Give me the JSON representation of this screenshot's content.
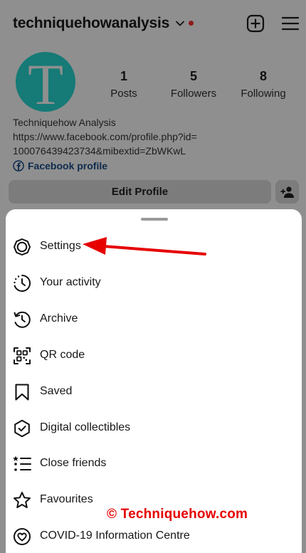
{
  "header": {
    "username": "techniquehowanalysis",
    "notification_dot_color": "#8c1a1a",
    "create_icon": "plus-square-icon",
    "menu_icon": "hamburger-menu-icon"
  },
  "profile": {
    "avatar_letter": "T",
    "avatar_color": "#167a77",
    "stats": [
      {
        "value": "1",
        "label": "Posts"
      },
      {
        "value": "5",
        "label": "Followers"
      },
      {
        "value": "8",
        "label": "Following"
      }
    ],
    "display_name": "Techniquehow Analysis",
    "link_line_1": "https://www.facebook.com/profile.php?id=",
    "link_line_2": "100076439423734&mibextid=ZbWKwL",
    "facebook_label": "Facebook profile",
    "edit_button": "Edit Profile"
  },
  "sheet": {
    "items": [
      {
        "label": "Settings",
        "icon": "settings-gear-icon"
      },
      {
        "label": "Your activity",
        "icon": "activity-clock-icon"
      },
      {
        "label": "Archive",
        "icon": "archive-clock-icon"
      },
      {
        "label": "QR code",
        "icon": "qr-code-icon"
      },
      {
        "label": "Saved",
        "icon": "bookmark-icon"
      },
      {
        "label": "Digital collectibles",
        "icon": "digital-collectibles-shield-icon"
      },
      {
        "label": "Close friends",
        "icon": "close-friends-list-icon"
      },
      {
        "label": "Favourites",
        "icon": "star-icon"
      },
      {
        "label": "COVID-19 Information Centre",
        "icon": "covid-heart-icon"
      }
    ]
  },
  "annotation": {
    "arrow_color": "#e60000",
    "watermark": "© Techniquehow.com"
  }
}
